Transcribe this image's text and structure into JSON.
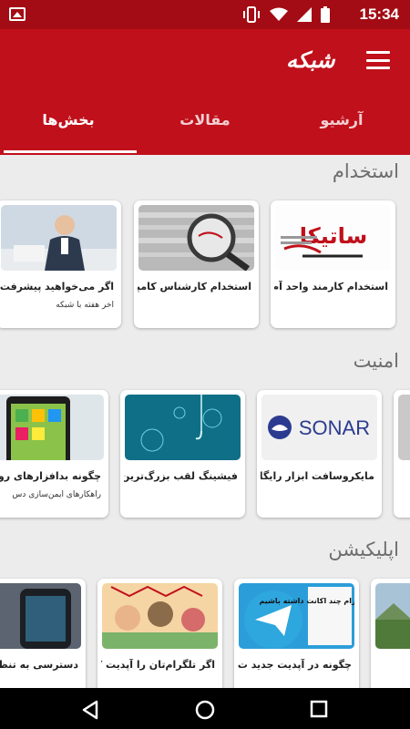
{
  "status": {
    "time": "15:34"
  },
  "app": {
    "logo": "شبکه"
  },
  "tabs": [
    {
      "label": "بخش‌ها",
      "active": true
    },
    {
      "label": "مقالات",
      "active": false
    },
    {
      "label": "آرشیو",
      "active": false
    }
  ],
  "sections": [
    {
      "title": "استخدام",
      "cards": [
        {
          "title": "استخدام کارمند واحد آم...",
          "subtitle": "",
          "thumb_text": "ساتیکا"
        },
        {
          "title": "استخدام کارشناس کامپی...",
          "subtitle": ""
        },
        {
          "title": "اگر می‌خواهید پیشرفت ...",
          "subtitle": "آخر هفته با شبکه"
        }
      ]
    },
    {
      "title": "امنیت",
      "cards": [
        {
          "title": "",
          "subtitle": ""
        },
        {
          "title": "مایکروسافت ابزار رایگان...",
          "subtitle": "",
          "thumb_text": "SONAR"
        },
        {
          "title": "فیشینگ لقب بزرگ‌ترین ...",
          "subtitle": ""
        },
        {
          "title": "چگونه بدافزارهای روی ...",
          "subtitle": "راهکارهای ایمن‌سازی دس"
        }
      ]
    },
    {
      "title": "اپلیکیشن",
      "cards": [
        {
          "title": "",
          "subtitle": ""
        },
        {
          "title": "چگونه در آپدیت جدید ت...",
          "subtitle": "",
          "thumb_text": "چگونه در تلگرام چند اکانت داشته باشیم"
        },
        {
          "title": "اگر تلگرام‌تان را آپدیت ک...",
          "subtitle": ""
        },
        {
          "title": "دسترسی به تنظیم...",
          "subtitle": ""
        }
      ]
    }
  ],
  "colors": {
    "statusbar": "#a30c14",
    "appbar": "#c0101b",
    "background": "#ececec"
  },
  "icons": [
    "image-icon",
    "vibrate-icon",
    "wifi-icon",
    "signal-icon",
    "battery-icon",
    "menu-icon",
    "back-icon",
    "home-icon",
    "recents-icon"
  ]
}
